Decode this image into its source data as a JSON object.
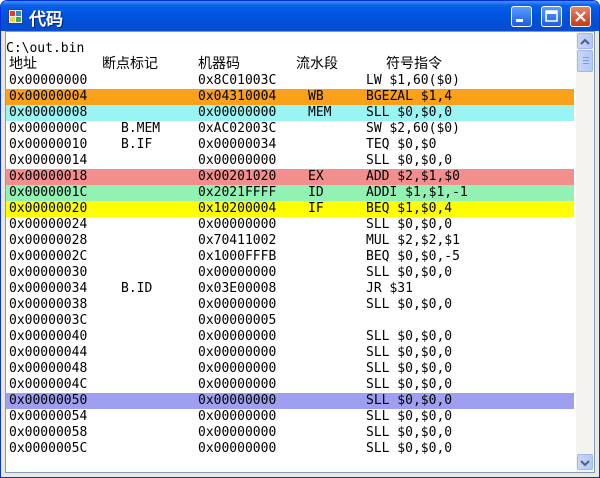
{
  "window": {
    "title": "代码"
  },
  "file_path": "C:\\out.bin",
  "headers": {
    "address": "地址",
    "breakpoint": "断点标记",
    "machine_code": "机器码",
    "pipeline_stage": "流水段",
    "instruction": "符号指令"
  },
  "colors": {
    "WB": "#f9a11b",
    "MEM": "#9bf4f4",
    "EX": "#f28e8e",
    "ID": "#92f2b3",
    "IF": "#ffff00",
    "highlight": "#9f9ff2"
  },
  "rows": [
    {
      "addr": "0x00000000",
      "bp": "",
      "code": "0x8C01003C",
      "stage": "",
      "ins": "LW $1,60($0)",
      "hl": ""
    },
    {
      "addr": "0x00000004",
      "bp": "",
      "code": "0x04310004",
      "stage": "WB",
      "ins": "BGEZAL $1,4",
      "hl": "WB"
    },
    {
      "addr": "0x00000008",
      "bp": "",
      "code": "0x00000000",
      "stage": "MEM",
      "ins": "SLL $0,$0,0",
      "hl": "MEM"
    },
    {
      "addr": "0x0000000C",
      "bp": "B.MEM",
      "code": "0xAC02003C",
      "stage": "",
      "ins": "SW $2,60($0)",
      "hl": ""
    },
    {
      "addr": "0x00000010",
      "bp": "B.IF",
      "code": "0x00000034",
      "stage": "",
      "ins": "TEQ $0,$0",
      "hl": ""
    },
    {
      "addr": "0x00000014",
      "bp": "",
      "code": "0x00000000",
      "stage": "",
      "ins": "SLL $0,$0,0",
      "hl": ""
    },
    {
      "addr": "0x00000018",
      "bp": "",
      "code": "0x00201020",
      "stage": "EX",
      "ins": "ADD $2,$1,$0",
      "hl": "EX"
    },
    {
      "addr": "0x0000001C",
      "bp": "",
      "code": "0x2021FFFF",
      "stage": "ID",
      "ins": "ADDI $1,$1,-1",
      "hl": "ID"
    },
    {
      "addr": "0x00000020",
      "bp": "",
      "code": "0x10200004",
      "stage": "IF",
      "ins": "BEQ $1,$0,4",
      "hl": "IF"
    },
    {
      "addr": "0x00000024",
      "bp": "",
      "code": "0x00000000",
      "stage": "",
      "ins": "SLL $0,$0,0",
      "hl": ""
    },
    {
      "addr": "0x00000028",
      "bp": "",
      "code": "0x70411002",
      "stage": "",
      "ins": "MUL $2,$2,$1",
      "hl": ""
    },
    {
      "addr": "0x0000002C",
      "bp": "",
      "code": "0x1000FFFB",
      "stage": "",
      "ins": "BEQ $0,$0,-5",
      "hl": ""
    },
    {
      "addr": "0x00000030",
      "bp": "",
      "code": "0x00000000",
      "stage": "",
      "ins": "SLL $0,$0,0",
      "hl": ""
    },
    {
      "addr": "0x00000034",
      "bp": "B.ID",
      "code": "0x03E00008",
      "stage": "",
      "ins": "JR $31",
      "hl": ""
    },
    {
      "addr": "0x00000038",
      "bp": "",
      "code": "0x00000000",
      "stage": "",
      "ins": "SLL $0,$0,0",
      "hl": ""
    },
    {
      "addr": "0x0000003C",
      "bp": "",
      "code": "0x00000005",
      "stage": "",
      "ins": "",
      "hl": ""
    },
    {
      "addr": "0x00000040",
      "bp": "",
      "code": "0x00000000",
      "stage": "",
      "ins": "SLL $0,$0,0",
      "hl": ""
    },
    {
      "addr": "0x00000044",
      "bp": "",
      "code": "0x00000000",
      "stage": "",
      "ins": "SLL $0,$0,0",
      "hl": ""
    },
    {
      "addr": "0x00000048",
      "bp": "",
      "code": "0x00000000",
      "stage": "",
      "ins": "SLL $0,$0,0",
      "hl": ""
    },
    {
      "addr": "0x0000004C",
      "bp": "",
      "code": "0x00000000",
      "stage": "",
      "ins": "SLL $0,$0,0",
      "hl": ""
    },
    {
      "addr": "0x00000050",
      "bp": "",
      "code": "0x00000000",
      "stage": "",
      "ins": "SLL $0,$0,0",
      "hl": "highlight"
    },
    {
      "addr": "0x00000054",
      "bp": "",
      "code": "0x00000000",
      "stage": "",
      "ins": "SLL $0,$0,0",
      "hl": ""
    },
    {
      "addr": "0x00000058",
      "bp": "",
      "code": "0x00000000",
      "stage": "",
      "ins": "SLL $0,$0,0",
      "hl": ""
    },
    {
      "addr": "0x0000005C",
      "bp": "",
      "code": "0x00000000",
      "stage": "",
      "ins": "SLL $0,$0,0",
      "hl": ""
    }
  ]
}
